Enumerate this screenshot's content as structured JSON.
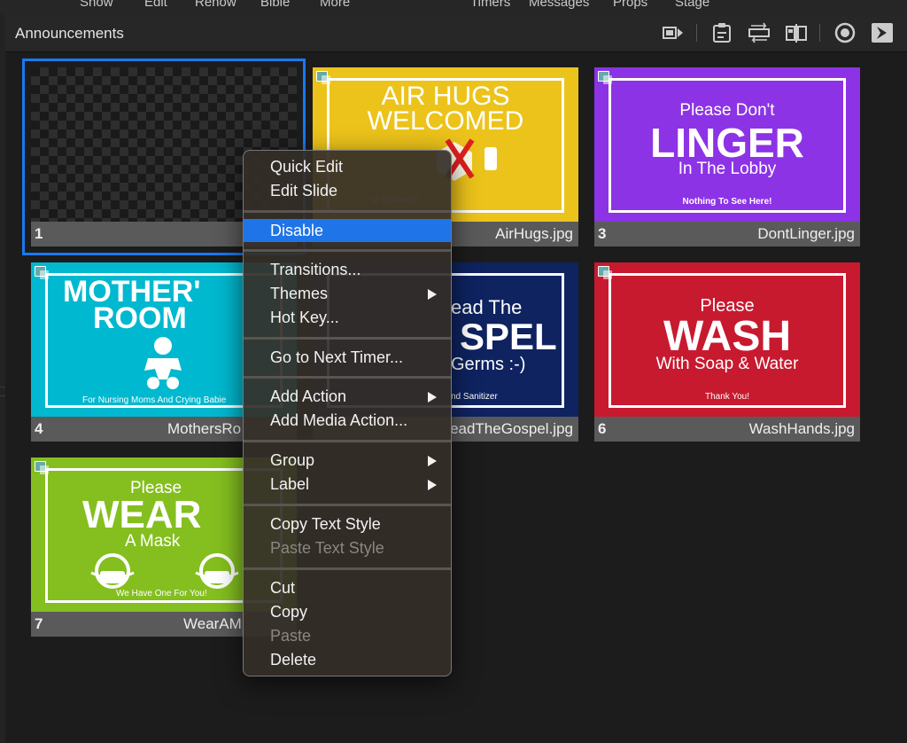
{
  "top_menu": [
    "Show",
    "Edit",
    "Renow",
    "Bible",
    "More",
    "Timers",
    "Messages",
    "Props",
    "Stage"
  ],
  "header": {
    "title": "Announcements"
  },
  "toolbar": [
    "slide-show-icon",
    "clipboard-icon",
    "loop-icon",
    "compare-icon",
    "record-icon",
    "play-icon"
  ],
  "slides": [
    {
      "num": "1",
      "file": ""
    },
    {
      "num": "",
      "file": "AirHugs.jpg",
      "lines": [
        "AIR HUGS",
        "WELCOMED",
        "ur Distance!"
      ]
    },
    {
      "num": "3",
      "file": "DontLinger.jpg",
      "lines": [
        "Please Don't",
        "LINGER",
        "In The Lobby",
        "Nothing To See Here!"
      ]
    },
    {
      "num": "4",
      "file": "MothersRo",
      "lines": [
        "MOTHER'",
        "ROOM",
        "For Nursing Moms And Crying Babie"
      ]
    },
    {
      "num": "",
      "file": "eadTheGospel.jpg",
      "lines": [
        "ead The",
        "SPEL",
        "Germs :-)",
        "nd Sanitizer"
      ]
    },
    {
      "num": "6",
      "file": "WashHands.jpg",
      "lines": [
        "Please",
        "WASH",
        "With Soap & Water",
        "Thank You!"
      ]
    },
    {
      "num": "7",
      "file": "WearAM",
      "lines": [
        "Please",
        "WEAR",
        "A Mask",
        "We Have One For You!"
      ]
    }
  ],
  "colors": {
    "airhugs": "#ecc31b",
    "linger": "#8c33e6",
    "mothers": "#00b8cf",
    "gospel": "#0e2360",
    "wash": "#c71a2f",
    "wear": "#84bf1f",
    "accent": "#1a78f0"
  },
  "context_menu": {
    "quick_edit": "Quick Edit",
    "edit_slide": "Edit Slide",
    "disable": "Disable",
    "transitions": "Transitions...",
    "themes": "Themes",
    "hot_key": "Hot Key...",
    "next_timer": "Go to Next Timer...",
    "add_action": "Add Action",
    "add_media_action": "Add Media Action...",
    "group": "Group",
    "label": "Label",
    "copy_text_style": "Copy Text Style",
    "paste_text_style": "Paste Text Style",
    "cut": "Cut",
    "copy": "Copy",
    "paste": "Paste",
    "delete": "Delete"
  }
}
